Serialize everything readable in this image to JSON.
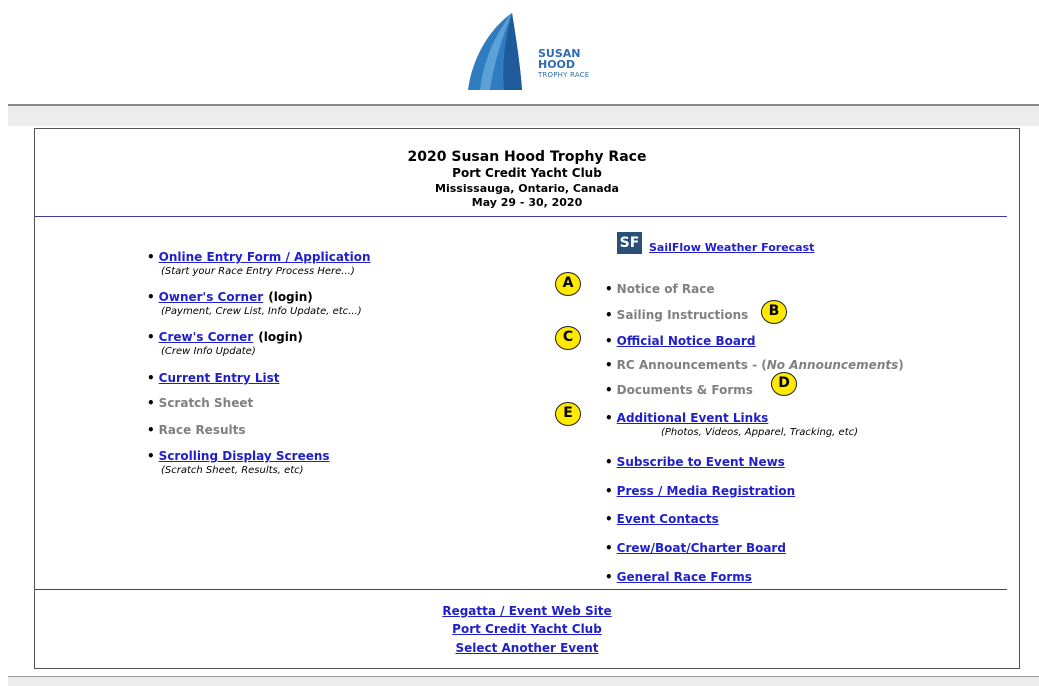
{
  "logo": {
    "line1": "SUSAN",
    "line2": "HOOD",
    "line3": "TROPHY RACE"
  },
  "header": {
    "title": "2020 Susan Hood Trophy Race",
    "club": "Port Credit Yacht Club",
    "location": "Mississauga, Ontario, Canada",
    "dates": "May 29 - 30, 2020"
  },
  "left": {
    "online_entry": "Online Entry Form / Application",
    "online_entry_sub": "(Start your Race Entry Process Here...)",
    "owners_corner": "Owner's Corner",
    "owners_login": "(login)",
    "owners_sub": "(Payment, Crew List, Info Update, etc...)",
    "crews_corner": "Crew's Corner",
    "crews_login": "(login)",
    "crews_sub": "(Crew Info Update)",
    "entry_list": "Current Entry List",
    "scratch_sheet": "Scratch Sheet",
    "race_results": "Race Results",
    "scrolling": "Scrolling Display Screens",
    "scrolling_sub": "(Scratch Sheet, Results, etc)"
  },
  "right": {
    "sf_icon": "SF",
    "sailflow": "SailFlow Weather Forecast",
    "notice_of_race": "Notice of Race",
    "sailing_instructions": "Sailing Instructions",
    "official_notice": "Official Notice Board",
    "rc_announcements": "RC Announcements - (",
    "rc_none": "No Announcements",
    "rc_close": ")",
    "documents": "Documents & Forms",
    "additional_links": "Additional Event Links",
    "additional_sub": "(Photos, Videos, Apparel, Tracking, etc)",
    "subscribe": "Subscribe to Event News",
    "press": "Press / Media Registration",
    "contacts": "Event Contacts",
    "crew_board": "Crew/Boat/Charter Board",
    "general_forms": "General Race Forms"
  },
  "badges": {
    "a": "A",
    "b": "B",
    "c": "C",
    "d": "D",
    "e": "E"
  },
  "footer": {
    "regatta": "Regatta / Event Web Site",
    "club": "Port Credit Yacht Club",
    "select": "Select Another Event"
  },
  "colors": {
    "link": "#1f1fcc",
    "disabled": "#808080",
    "badge": "#ffe900",
    "rule": "#3c3c9c"
  }
}
